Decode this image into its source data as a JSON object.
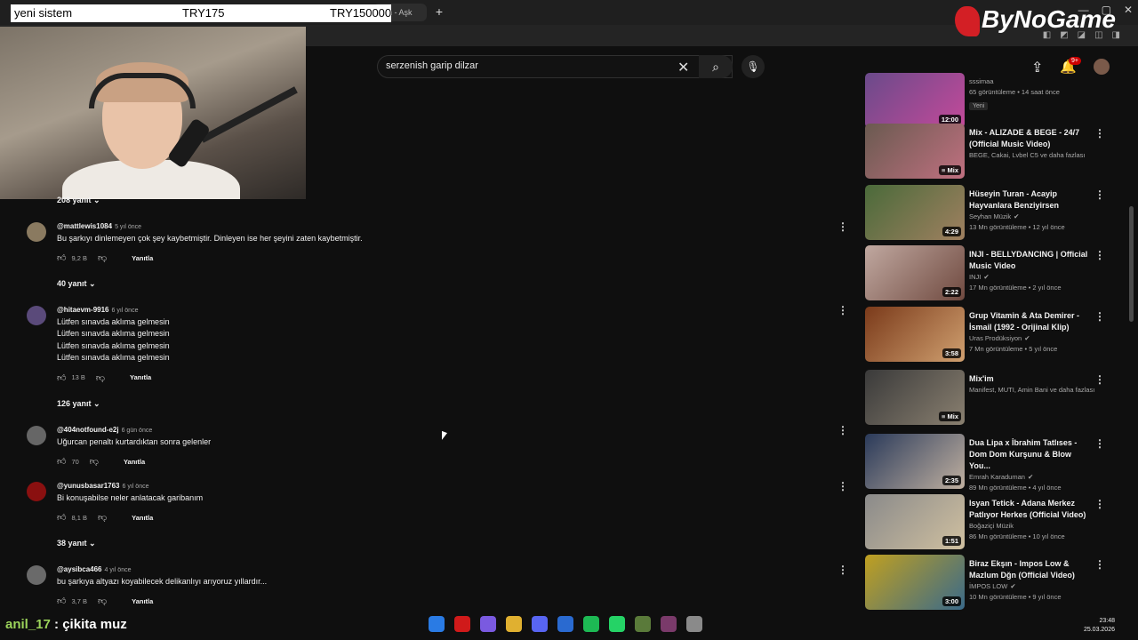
{
  "browser": {
    "active_tab_fragment": "ren - Aşk",
    "new_tab_icon": "plus-icon"
  },
  "stream_overlay": {
    "left_text": "yeni sistem",
    "middle_text": "TRY175",
    "right_text": "TRY150000",
    "logo_text": "ByNoGame",
    "chat_user": "anil_17",
    "chat_separator": ":",
    "chat_message": "çikita muz"
  },
  "youtube_header": {
    "search_query": "serzenish garip dilzar",
    "notification_badge": "9+"
  },
  "comments": {
    "top_replies": "208 yanıt",
    "items": [
      {
        "author": "@mattlewis1084",
        "time": "5 yıl önce",
        "lines": [
          "Bu şarkıyı dinlemeyen çok şey kaybetmiştir. Dinleyen ise her şeyini zaten kaybetmiştir."
        ],
        "likes": "9,2 B",
        "reply_label": "Yanıtla",
        "replies": "40 yanıt",
        "avatar_color": "#8a7a60"
      },
      {
        "author": "@hitaevm-9916",
        "time": "6 yıl önce",
        "lines": [
          "Lütfen sınavda aklıma gelmesin",
          "Lütfen sınavda aklıma gelmesin",
          "Lütfen sınavda aklıma gelmesin",
          "Lütfen sınavda aklıma gelmesin"
        ],
        "likes": "13 B",
        "reply_label": "Yanıtla",
        "replies": "126 yanıt",
        "avatar_color": "#5a4a7a"
      },
      {
        "author": "@404notfound-e2j",
        "time": "6 gün önce",
        "lines": [
          "Uğurcan penaltı kurtardıktan sonra gelenler"
        ],
        "likes": "70",
        "reply_label": "Yanıtla",
        "replies": "",
        "avatar_color": "#666666"
      },
      {
        "author": "@yunusbasar1763",
        "time": "6 yıl önce",
        "lines": [
          "Bi konuşabilse neler anlatacak garibanım"
        ],
        "likes": "8,1 B",
        "reply_label": "Yanıtla",
        "replies": "38 yanıt",
        "avatar_color": "#8a1010"
      },
      {
        "author": "@aysibca466",
        "time": "4 yıl önce",
        "lines": [
          "bu şarkıya altyazı koyabilecek delikanlıyı arıyoruz yıllardır..."
        ],
        "likes": "3,7 B",
        "reply_label": "Yanıtla",
        "replies": "",
        "avatar_color": "#6a6a6a"
      }
    ]
  },
  "sidebar_videos": [
    {
      "title": "",
      "channel": "sssimaa",
      "meta": "65 görüntüleme • 14 saat önce",
      "duration": "12:00",
      "badge": "Yeni",
      "verified": false,
      "thumb": [
        "#6a4a8a",
        "#c44a9a"
      ]
    },
    {
      "title": "Mix - ALIZADE & BEGE - 24/7 (Official Music Video)",
      "channel": "BEGE, Cakai, Lvbel C5 ve daha fazlası",
      "meta": "",
      "duration": "Mix",
      "badge": "",
      "verified": false,
      "thumb": [
        "#6a5a50",
        "#c07080"
      ]
    },
    {
      "title": "Hüseyin  Turan - Acayip Hayvanlara Benziyirsen",
      "channel": "Seyhan Müzik",
      "meta": "13 Mn görüntüleme • 12 yıl önce",
      "duration": "4:29",
      "badge": "",
      "verified": true,
      "thumb": [
        "#4a6a3a",
        "#a08060"
      ]
    },
    {
      "title": "INJI - BELLYDANCING | Official Music Video",
      "channel": "INJI",
      "meta": "17 Mn görüntüleme • 2 yıl önce",
      "duration": "2:22",
      "badge": "",
      "verified": true,
      "thumb": [
        "#c0a8a0",
        "#704a40"
      ]
    },
    {
      "title": "Grup Vitamin & Ata Demirer  - İsmail (1992 - Orijinal Klip)",
      "channel": "Uras Prodüksiyon",
      "meta": "7 Mn görüntüleme • 5 yıl önce",
      "duration": "3:58",
      "badge": "",
      "verified": true,
      "thumb": [
        "#7a3a1a",
        "#d0a070"
      ]
    },
    {
      "title": "Mix'im",
      "channel": "Manifest, MUTI, Amin Bani ve daha fazlası",
      "meta": "",
      "duration": "Mix",
      "badge": "",
      "verified": false,
      "thumb": [
        "#3a3a3a",
        "#8a8070"
      ]
    },
    {
      "title": "Dua Lipa x İbrahim Tatlıses - Dom Dom Kurşunu & Blow You...",
      "channel": "Emrah Karaduman",
      "meta": "89 Mn görüntüleme • 4 yıl önce",
      "duration": "2:35",
      "badge": "",
      "verified": true,
      "thumb": [
        "#2a3a5a",
        "#c0b0a0"
      ]
    },
    {
      "title": "Isyan Tetick - Adana Merkez Patlıyor Herkes (Official Video)",
      "channel": "Boğaziçi Müzik",
      "meta": "86 Mn görüntüleme • 10 yıl önce",
      "duration": "1:51",
      "badge": "",
      "verified": false,
      "thumb": [
        "#8a8a8a",
        "#d0c0a0"
      ]
    },
    {
      "title": "Biraz Ekşın - Impos Low & Mazlum Dğn (Official Video)",
      "channel": "İMPOS LOW",
      "meta": "10 Mn görüntüleme • 9 yıl önce",
      "duration": "3:00",
      "badge": "",
      "verified": true,
      "thumb": [
        "#c0a020",
        "#3a6a8a"
      ]
    }
  ],
  "taskbar": {
    "clock_time": "23:48",
    "clock_date": "25.03.2026",
    "app_colors": [
      "#2a7be4",
      "#d01a1a",
      "#7a5ae0",
      "#e0b030",
      "#5865f2",
      "#2a6ad0",
      "#1db954",
      "#25d366",
      "#5a7a3a",
      "#7a3a6a",
      "#8a8a8a"
    ]
  }
}
